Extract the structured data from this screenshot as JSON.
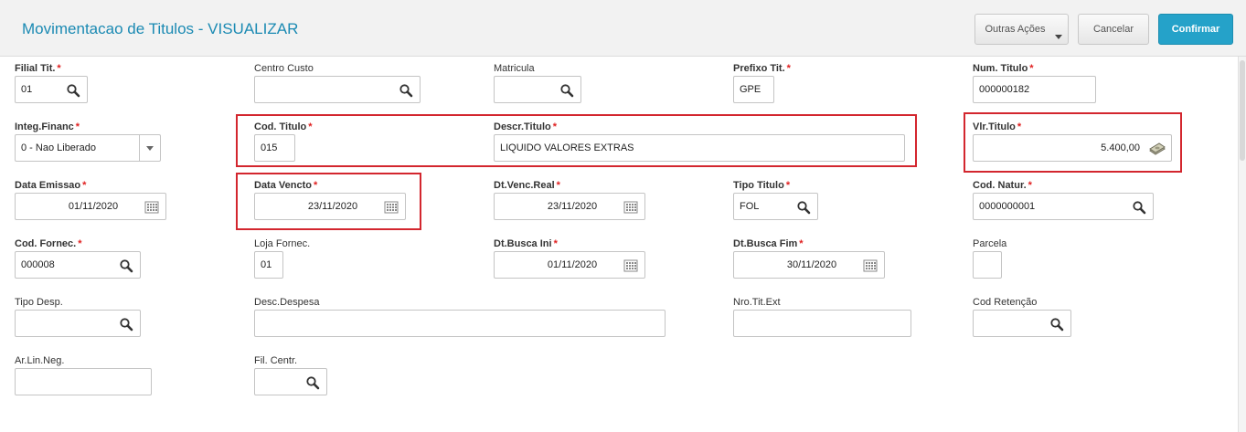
{
  "header": {
    "title": "Movimentacao de Titulos - VISUALIZAR",
    "outras_acoes": "Outras Ações",
    "cancelar": "Cancelar",
    "confirmar": "Confirmar"
  },
  "fields": {
    "filial": {
      "label": "Filial Tit.",
      "value": "01",
      "required": "*"
    },
    "centro_custo": {
      "label": "Centro Custo",
      "value": ""
    },
    "matricula": {
      "label": "Matricula",
      "value": ""
    },
    "prefixo": {
      "label": "Prefixo Tit.",
      "value": "GPE",
      "required": "*"
    },
    "num_titulo": {
      "label": "Num. Titulo",
      "value": "000000182",
      "required": "*"
    },
    "integ_financ": {
      "label": "Integ.Financ",
      "value": "0 - Nao Liberado",
      "required": "*"
    },
    "cod_titulo": {
      "label": "Cod. Titulo",
      "value": "015",
      "required": "*"
    },
    "descr_titulo": {
      "label": "Descr.Titulo",
      "value": "LIQUIDO VALORES EXTRAS",
      "required": "*"
    },
    "vlr_titulo": {
      "label": "Vlr.Titulo",
      "value": "5.400,00",
      "required": "*"
    },
    "data_emissao": {
      "label": "Data Emissao",
      "value": "01/11/2020",
      "required": "*"
    },
    "data_vencto": {
      "label": "Data Vencto",
      "value": "23/11/2020",
      "required": "*"
    },
    "dt_venc_real": {
      "label": "Dt.Venc.Real",
      "value": "23/11/2020",
      "required": "*"
    },
    "tipo_titulo": {
      "label": "Tipo Titulo",
      "value": "FOL",
      "required": "*"
    },
    "cod_natur": {
      "label": "Cod. Natur.",
      "value": "0000000001",
      "required": "*"
    },
    "cod_fornec": {
      "label": "Cod. Fornec.",
      "value": "000008",
      "required": "*"
    },
    "loja_fornec": {
      "label": "Loja Fornec.",
      "value": "01"
    },
    "dt_busca_ini": {
      "label": "Dt.Busca Ini",
      "value": "01/11/2020",
      "required": "*"
    },
    "dt_busca_fim": {
      "label": "Dt.Busca Fim",
      "value": "30/11/2020",
      "required": "*"
    },
    "parcela": {
      "label": "Parcela",
      "value": ""
    },
    "tipo_desp": {
      "label": "Tipo Desp.",
      "value": ""
    },
    "desc_despesa": {
      "label": "Desc.Despesa",
      "value": ""
    },
    "nro_tit_ext": {
      "label": "Nro.Tit.Ext",
      "value": ""
    },
    "cod_retencao": {
      "label": "Cod Retenção",
      "value": ""
    },
    "ar_lin_neg": {
      "label": "Ar.Lin.Neg.",
      "value": ""
    },
    "fil_centr": {
      "label": "Fil. Centr.",
      "value": ""
    }
  },
  "icons": {
    "search": "search-icon",
    "calendar": "calendar-icon",
    "money": "money-icon",
    "dropdown": "chevron-down-icon"
  },
  "colors": {
    "title": "#1b8ab3",
    "confirm": "#25a2c9",
    "required": "#e02020",
    "highlight": "#d3262e"
  }
}
